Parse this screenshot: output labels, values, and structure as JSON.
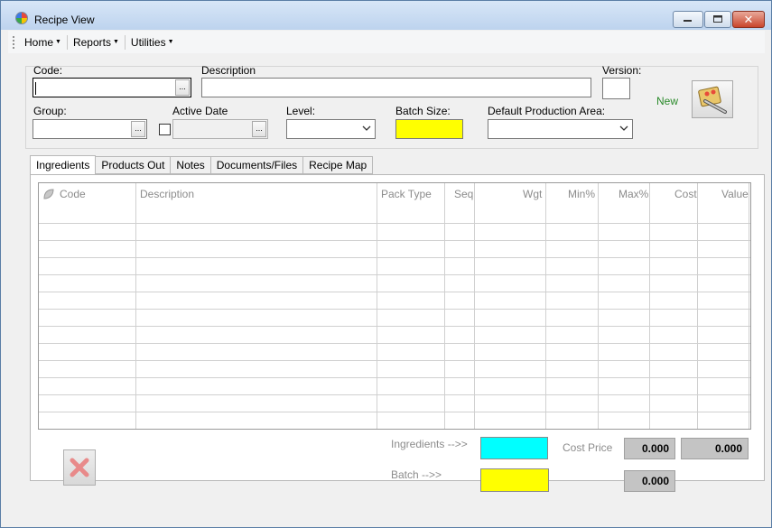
{
  "window": {
    "title": "Recipe View",
    "close_glyph": "✕"
  },
  "menu": [
    {
      "label": "Home"
    },
    {
      "label": "Reports"
    },
    {
      "label": "Utilities"
    }
  ],
  "form": {
    "code_label": "Code:",
    "code_value": "",
    "description_label": "Description",
    "description_value": "",
    "version_label": "Version:",
    "version_value": "",
    "new_label": "New",
    "group_label": "Group:",
    "group_value": "",
    "active_date_label": "Active Date",
    "active_date_checked": false,
    "active_date_value": "",
    "level_label": "Level:",
    "level_value": "",
    "batch_size_label": "Batch Size:",
    "batch_size_value": "",
    "default_area_label": "Default Production Area:",
    "default_area_value": "",
    "ellipsis": "..."
  },
  "tabs": [
    {
      "label": "Ingredients",
      "active": true
    },
    {
      "label": "Products Out",
      "active": false
    },
    {
      "label": "Notes",
      "active": false
    },
    {
      "label": "Documents/Files",
      "active": false
    },
    {
      "label": "Recipe Map",
      "active": false
    }
  ],
  "grid": {
    "columns": [
      "Code",
      "Description",
      "Pack Type",
      "Seq",
      "Wgt",
      "Min%",
      "Max%",
      "Cost",
      "Value"
    ],
    "rows": []
  },
  "totals": {
    "ingredients_label": "Ingredients -->>",
    "batch_label": "Batch -->>",
    "cost_price_label": "Cost Price",
    "cost_price_value": "0.000",
    "value_total": "0.000",
    "batch_value": "0.000"
  },
  "colors": {
    "batch_size": "#ffff00",
    "ingredients_box": "#00ffff",
    "batch_box": "#ffff00",
    "new_text": "#2a8a2a"
  },
  "icons": {
    "new_button": "recipe-new-icon",
    "delete_button": "delete-x-icon",
    "grid_header": "leaf-icon"
  }
}
